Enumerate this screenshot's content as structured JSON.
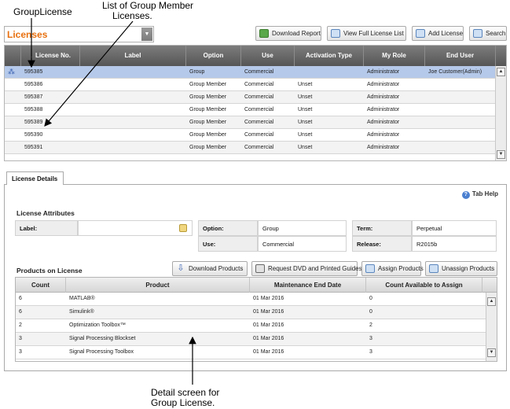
{
  "annotations": {
    "group_license": "GroupLicense",
    "list_line1": "List of Group Member",
    "list_line2": "Licenses.",
    "detail_line1": "Detail screen for",
    "detail_line2": "Group License."
  },
  "toolbar": {
    "dropdown_value": "Licenses",
    "download_report": "Download Report",
    "view_full": "View Full License List",
    "add_license": "Add License",
    "search": "Search"
  },
  "licenses": {
    "columns": [
      "License No.",
      "Label",
      "Option",
      "Use",
      "Activation Type",
      "My Role",
      "End User"
    ],
    "rows": [
      {
        "no": "595385",
        "label": "",
        "option": "Group",
        "use": "Commercial",
        "activation": "",
        "role": "Administrator",
        "end_user": "Joe Customer(Admin)",
        "selected": true
      },
      {
        "no": "595386",
        "label": "",
        "option": "Group Member",
        "use": "Commercial",
        "activation": "Unset",
        "role": "Administrator",
        "end_user": ""
      },
      {
        "no": "595387",
        "label": "",
        "option": "Group Member",
        "use": "Commercial",
        "activation": "Unset",
        "role": "Administrator",
        "end_user": ""
      },
      {
        "no": "595388",
        "label": "",
        "option": "Group Member",
        "use": "Commercial",
        "activation": "Unset",
        "role": "Administrator",
        "end_user": ""
      },
      {
        "no": "595389",
        "label": "",
        "option": "Group Member",
        "use": "Commercial",
        "activation": "Unset",
        "role": "Administrator",
        "end_user": ""
      },
      {
        "no": "595390",
        "label": "",
        "option": "Group Member",
        "use": "Commercial",
        "activation": "Unset",
        "role": "Administrator",
        "end_user": ""
      },
      {
        "no": "595391",
        "label": "",
        "option": "Group Member",
        "use": "Commercial",
        "activation": "Unset",
        "role": "Administrator",
        "end_user": ""
      }
    ]
  },
  "details": {
    "tab_label": "License Details",
    "tab_help": "Tab Help",
    "attributes_title": "License Attributes",
    "label_label": "Label:",
    "label_value": "",
    "option_label": "Option:",
    "option_value": "Group",
    "use_label": "Use:",
    "use_value": "Commercial",
    "term_label": "Term:",
    "term_value": "Perpetual",
    "release_label": "Release:",
    "release_value": "R2015b",
    "products_title": "Products on License",
    "download_products": "Download Products",
    "request_dvd": "Request DVD and Printed Guides",
    "assign_products": "Assign Products",
    "unassign_products": "Unassign Products"
  },
  "products": {
    "columns": [
      "Count",
      "Product",
      "Maintenance End Date",
      "Count Available to Assign"
    ],
    "rows": [
      {
        "count": "6",
        "product": "MATLAB®",
        "end": "01 Mar 2016",
        "avail": "0"
      },
      {
        "count": "6",
        "product": "Simulink®",
        "end": "01 Mar 2016",
        "avail": "0"
      },
      {
        "count": "2",
        "product": "Optimization Toolbox™",
        "end": "01 Mar 2016",
        "avail": "2"
      },
      {
        "count": "3",
        "product": "Signal Processing Blockset",
        "end": "01 Mar 2016",
        "avail": "3"
      },
      {
        "count": "3",
        "product": "Signal Processing Toolbox",
        "end": "01 Mar 2016",
        "avail": "3"
      }
    ]
  }
}
